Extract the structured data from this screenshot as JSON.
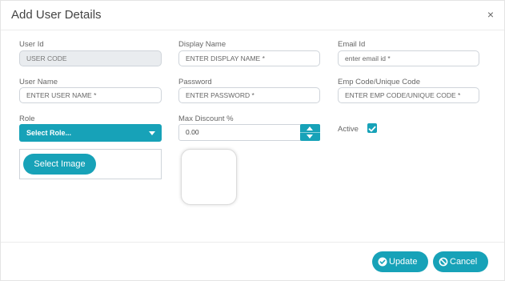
{
  "dialog": {
    "title": "Add User Details",
    "close_glyph": "×"
  },
  "fields": {
    "user_id": {
      "label": "User Id",
      "value": "USER CODE"
    },
    "display_name": {
      "label": "Display Name",
      "placeholder": "ENTER DISPLAY NAME *"
    },
    "email_id": {
      "label": "Email Id",
      "placeholder": "enter email id *"
    },
    "user_name": {
      "label": "User Name",
      "placeholder": "ENTER USER NAME *"
    },
    "password": {
      "label": "Password",
      "placeholder": "ENTER PASSWORD *"
    },
    "emp_code": {
      "label": "Emp Code/Unique Code",
      "placeholder": "ENTER EMP CODE/UNIQUE CODE *"
    },
    "role": {
      "label": "Role",
      "selected": "Select Role..."
    },
    "max_discount": {
      "label": "Max Discount %",
      "value": "0.00"
    },
    "active": {
      "label": "Active",
      "checked": true
    }
  },
  "image": {
    "select_label": "Select Image"
  },
  "footer": {
    "update_label": "Update",
    "cancel_label": "Cancel"
  },
  "colors": {
    "accent": "#17a2b8"
  },
  "icons": [
    "close-icon",
    "chevron-down-icon",
    "spin-up-icon",
    "spin-down-icon",
    "checkmark-icon",
    "ban-icon"
  ]
}
